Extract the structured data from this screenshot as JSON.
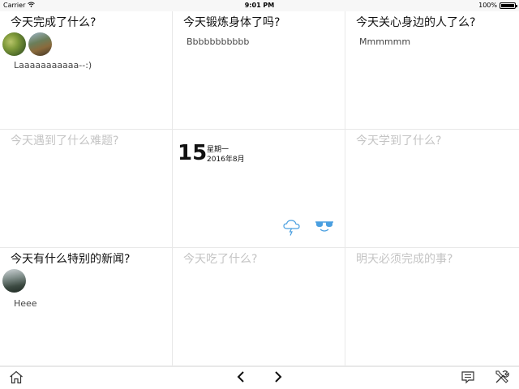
{
  "statusbar": {
    "carrier": "Carrier",
    "time": "9:01 PM",
    "battery": "100%"
  },
  "cells": [
    {
      "title": "今天完成了什么?",
      "state": "filled",
      "note": "Laaaaaaaaaaa--:)"
    },
    {
      "title": "今天锻炼身体了吗?",
      "state": "filled",
      "note": "Bbbbbbbbbbb"
    },
    {
      "title": "今天关心身边的人了么?",
      "state": "filled",
      "note": "Mmmmmm"
    },
    {
      "title": "今天遇到了什么难题?",
      "state": "empty"
    },
    {
      "title": "今天学到了什么?",
      "state": "empty"
    },
    {
      "title": "今天有什么特别的新闻?",
      "state": "filled",
      "note": "Heee"
    },
    {
      "title": "今天吃了什么?",
      "state": "empty"
    },
    {
      "title": "明天必须完成的事?",
      "state": "empty"
    }
  ],
  "date": {
    "day": "15",
    "weekday": "星期一",
    "month": "2016年8月"
  },
  "weather": {
    "icons": [
      "storm-cloud-icon",
      "sunglasses-icon"
    ],
    "accent_color": "#4a9fe0"
  },
  "toolbar": {
    "icons": [
      "home-icon",
      "chevron-left-icon",
      "chevron-right-icon",
      "notes-icon",
      "tools-icon"
    ]
  }
}
